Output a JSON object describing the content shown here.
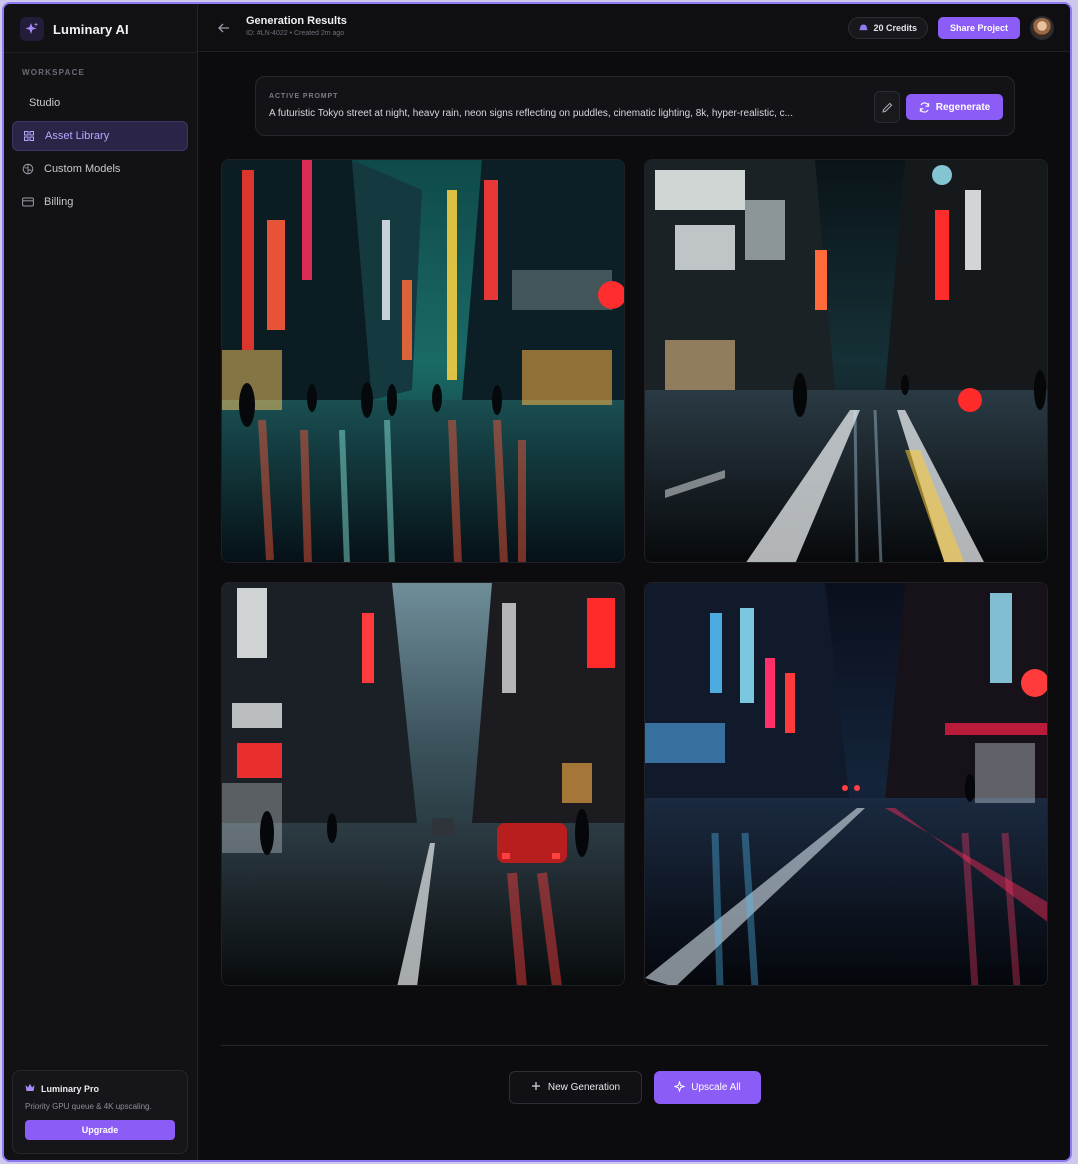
{
  "brand": {
    "name": "Luminary AI",
    "icon": "sparkle-icon"
  },
  "sidebar": {
    "section_label": "WORKSPACE",
    "items": [
      {
        "label": "Studio",
        "icon": ""
      },
      {
        "label": "Asset Library",
        "icon": "grid-icon",
        "active": true
      },
      {
        "label": "Custom Models",
        "icon": "brain-icon"
      },
      {
        "label": "Billing",
        "icon": "card-icon"
      }
    ],
    "pro": {
      "title": "Luminary Pro",
      "description": "Priority GPU queue & 4K upscaling.",
      "button": "Upgrade"
    }
  },
  "header": {
    "title": "Generation Results",
    "subtitle": "ID: #LN-4022 • Created 2m ago",
    "credits": "20 Credits",
    "share": "Share Project"
  },
  "prompt": {
    "label": "ACTIVE PROMPT",
    "text": "A futuristic Tokyo street at night, heavy rain, neon signs reflecting on puddles, cinematic lighting, 8k, hyper-realistic, c...",
    "regenerate": "Regenerate"
  },
  "footer": {
    "new_generation": "New Generation",
    "upscale_all": "Upscale All"
  },
  "colors": {
    "accent": "#8b5cf6",
    "background": "#0c0c0f",
    "sidebar": "#121215"
  }
}
